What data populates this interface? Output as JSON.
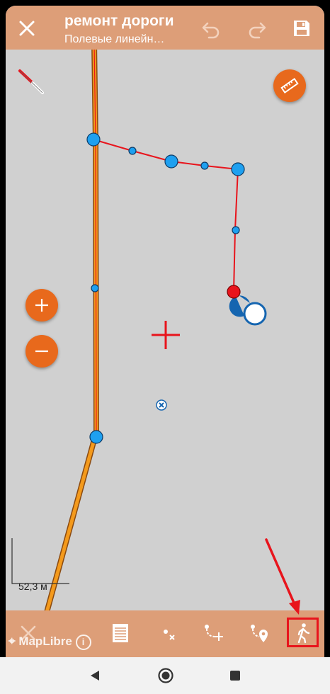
{
  "header": {
    "title": "ремонт дороги",
    "subtitle": "Полевые линейн…",
    "icons": [
      "close-icon",
      "undo-icon",
      "redo-icon",
      "save-icon"
    ]
  },
  "map": {
    "scale_label": "52,3 м",
    "attribution": "MapLibre",
    "colors": {
      "accent": "#e8691c",
      "line": "#e8141c",
      "vertex": "#1ea0f0",
      "road": "#f49a1c"
    }
  },
  "toolbar": {
    "icons": [
      "close-icon",
      "list-icon",
      "delete-point-icon",
      "add-vertex-icon",
      "add-point-location-icon",
      "walk-icon"
    ]
  },
  "nav": {
    "icons": [
      "back-icon",
      "home-icon",
      "recents-icon"
    ]
  }
}
